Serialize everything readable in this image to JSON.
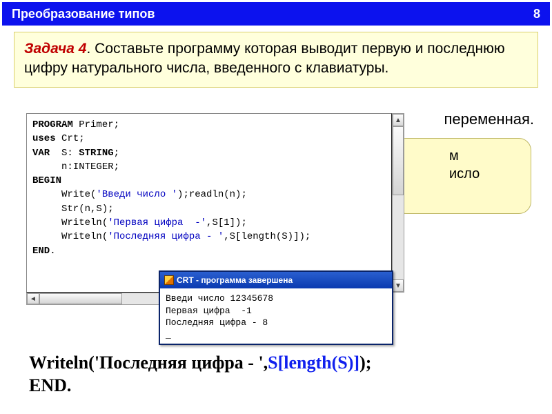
{
  "titlebar": {
    "title": "Преобразование типов",
    "page": "8"
  },
  "task": {
    "label": "Задача 4",
    "dot": ". ",
    "text": "Составьте программу которая выводит первую и последнюю цифру натурального числа, введенного с клавиатуры."
  },
  "bg_text": "переменная.",
  "yellow_peek": {
    "line1": "м",
    "line2": "исло"
  },
  "code": {
    "l1a": "PROGRAM",
    "l1b": " Primer;",
    "l2a": "uses",
    "l2b": " Crt;",
    "l3a": "VAR",
    "l3b": "  S: ",
    "l3c": "STRING",
    "l3d": ";",
    "l4": "     n:INTEGER;",
    "l5": "BEGIN",
    "l6a": "     Write(",
    "l6b": "'Введи число '",
    "l6c": ");readln(n);",
    "l7": "     Str(n,S);",
    "l8a": "     Writeln(",
    "l8b": "'Первая цифра  -'",
    "l8c": ",S[1]);",
    "l9a": "     Writeln(",
    "l9b": "'Последняя цифра - '",
    "l9c": ",S[length(S)]);",
    "l10a": "END",
    "l10b": "."
  },
  "crt": {
    "title": "CRT - программа завершена",
    "out1": "Введи число 12345678",
    "out2": "Первая цифра  -1",
    "out3": "Последняя цифра - 8",
    "cursor": "_"
  },
  "bottom": {
    "line1a": "   Writeln('Последняя цифра - ',",
    "line1b": "S[length(S)]",
    "line1c": ");",
    "line2": "END."
  }
}
